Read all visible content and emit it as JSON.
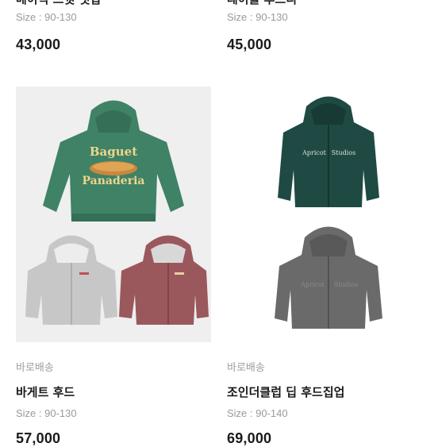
{
  "products": [
    {
      "name": "베이직 스웻 셋업",
      "size": "Size : 90-130",
      "price": "43,000"
    },
    {
      "name": "레이블 후드티",
      "size": "Size : 90-130",
      "price": "45,000"
    },
    {
      "shipping": "바로배송",
      "name": "바게트 후드",
      "size": "Size : 90-130",
      "price": "57,000",
      "graphic_text": [
        "Baguet",
        "Panaderia"
      ],
      "colors": [
        "#3f8266",
        "#c7c7c7",
        "#9a585c"
      ]
    },
    {
      "shipping": "바로배송",
      "name": "조인더클럽 딥 후드집업",
      "size": "Size : 90-140",
      "price": "69,000",
      "graphic_text": [
        "Apricot",
        "Studios"
      ],
      "colors": [
        "#1f4a44",
        "#6a6a6a"
      ]
    }
  ]
}
